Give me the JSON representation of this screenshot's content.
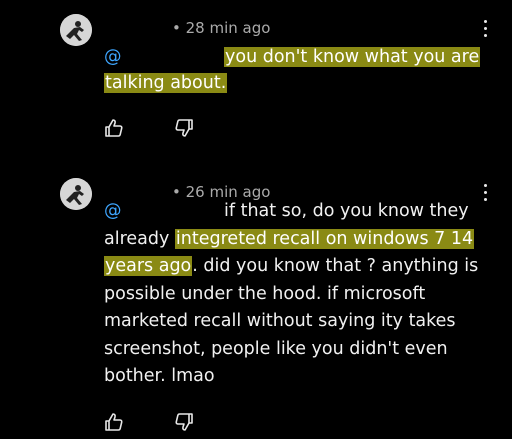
{
  "comments": [
    {
      "time": "• 28 min ago",
      "mention": "@",
      "text_hl_1": "you don't know what you are",
      "text_hl_2": "talking about."
    },
    {
      "time": "• 26 min ago",
      "mention": "@",
      "text_1": "if that so, do you know they",
      "text_2": "already ",
      "text_hl_1": "integreted recall on windows 7 14",
      "text_hl_2": "years ago",
      "text_3": ". did you know that ? anything is possible under the hood. if microsoft marketed recall without saying ity takes screenshot, people like you didn't even bother. lmao"
    }
  ],
  "icons": {
    "avatar": "avatar-icon",
    "more": "more-vert-icon",
    "like": "thumb-up-icon",
    "dislike": "thumb-down-icon"
  },
  "colors": {
    "background": "#000000",
    "text": "#f1f1f1",
    "meta": "#aaaaaa",
    "mention": "#3ea6ff",
    "highlight": "#8a8a14"
  }
}
